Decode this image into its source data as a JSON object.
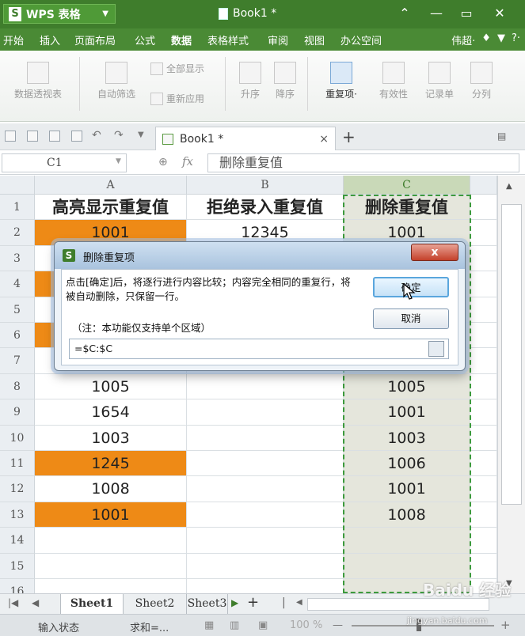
{
  "titlebar": {
    "app_name": "WPS 表格",
    "doc_title": "Book1 *",
    "colors": {
      "bar": "#3f7d2c"
    }
  },
  "menu": {
    "items": [
      "开始",
      "插入",
      "页面布局",
      "公式",
      "数据",
      "表格样式",
      "审阅",
      "视图",
      "办公空间"
    ],
    "active": "数据",
    "right": [
      "伟超·",
      "?·"
    ]
  },
  "ribbon": {
    "pivot": "数据透视表",
    "autofilter": "自动筛选",
    "show_all": "全部显示",
    "reapply": "重新应用",
    "sort_asc": "升序",
    "sort_desc": "降序",
    "duplicates": "重复项·",
    "validation": "有效性",
    "records": "记录单",
    "split": "分列"
  },
  "doctab": {
    "label": "Book1 *",
    "close": "×",
    "add": "+"
  },
  "formula_bar": {
    "name_box": "C1",
    "fx": "fx",
    "content": "删除重复值"
  },
  "grid": {
    "columns": [
      "A",
      "B",
      "C"
    ],
    "rows": [
      {
        "n": "1",
        "a": "高亮显示重复值",
        "b": "拒绝录入重复值",
        "c": "删除重复值",
        "a_orange": false
      },
      {
        "n": "2",
        "a": "1001",
        "b": "12345",
        "c": "1001",
        "a_orange": true
      },
      {
        "n": "3",
        "a": "",
        "b": "",
        "c": "",
        "a_orange": false
      },
      {
        "n": "4",
        "a": "",
        "b": "",
        "c": "",
        "a_orange": true
      },
      {
        "n": "5",
        "a": "",
        "b": "",
        "c": "",
        "a_orange": false
      },
      {
        "n": "6",
        "a": "",
        "b": "",
        "c": "",
        "a_orange": true
      },
      {
        "n": "7",
        "a": "",
        "b": "",
        "c": "",
        "a_orange": false
      },
      {
        "n": "8",
        "a": "1005",
        "b": "",
        "c": "1005",
        "a_orange": false
      },
      {
        "n": "9",
        "a": "1654",
        "b": "",
        "c": "1001",
        "a_orange": false
      },
      {
        "n": "10",
        "a": "1003",
        "b": "",
        "c": "1003",
        "a_orange": false
      },
      {
        "n": "11",
        "a": "1245",
        "b": "",
        "c": "1006",
        "a_orange": true
      },
      {
        "n": "12",
        "a": "1008",
        "b": "",
        "c": "1001",
        "a_orange": false
      },
      {
        "n": "13",
        "a": "1001",
        "b": "",
        "c": "1008",
        "a_orange": true
      },
      {
        "n": "14",
        "a": "",
        "b": "",
        "c": "",
        "a_orange": false
      },
      {
        "n": "15",
        "a": "",
        "b": "",
        "c": "",
        "a_orange": false
      },
      {
        "n": "16",
        "a": "",
        "b": "",
        "c": "",
        "a_orange": false
      }
    ],
    "highlight_color": "#ee8a16"
  },
  "sheets": {
    "tabs": [
      "Sheet1",
      "Sheet2",
      "Sheet3"
    ],
    "active": "Sheet1",
    "add": "+"
  },
  "status": {
    "input_state": "输入状态",
    "sum": "求和=...",
    "zoom": "100 %"
  },
  "dialog": {
    "title": "删除重复项",
    "close": "x",
    "message": "点击[确定]后，将逐行进行内容比较；内容完全相同的重复行，将被自动删除，只保留一行。",
    "note": "（注：本功能仅支持单个区域）",
    "ok": "确定",
    "cancel": "取消",
    "range": "=$C:$C"
  },
  "watermark": {
    "text": "Baidu 经验",
    "url": "jingyan.baidu.com"
  }
}
